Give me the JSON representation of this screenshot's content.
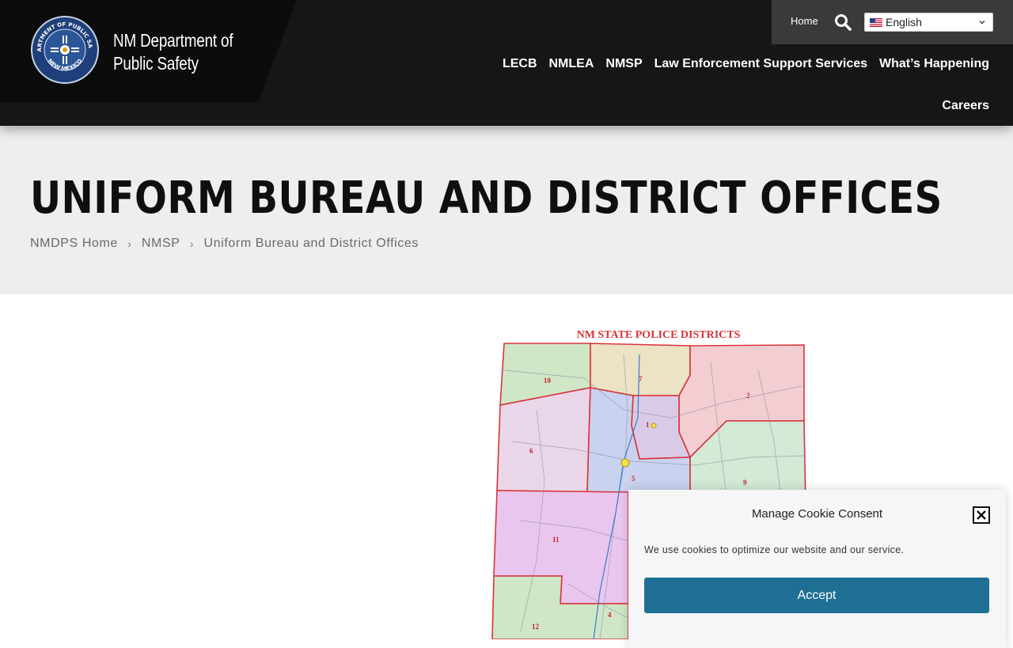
{
  "brand": {
    "line1": "NM Department of",
    "line2": "Public Safety",
    "seal_top_text": "DEPARTMENT OF PUBLIC SAFETY",
    "seal_bottom_text": "NEW MEXICO"
  },
  "utility": {
    "home_label": "Home",
    "search_icon": "search-icon",
    "language": "English"
  },
  "nav": {
    "items": [
      "LECB",
      "NMLEA",
      "NMSP",
      "Law Enforcement Support Services",
      "What’s Happening",
      "Careers"
    ]
  },
  "hero": {
    "title": "UNIFORM BUREAU AND DISTRICT OFFICES",
    "breadcrumb": [
      "NMDPS Home",
      "NMSP",
      "Uniform Bureau and District Offices"
    ],
    "separator": "›"
  },
  "map": {
    "title": "NM STATE POLICE  DISTRICTS",
    "districts": [
      "10",
      "7",
      "2",
      "1",
      "6",
      "5",
      "9",
      "11",
      "4",
      "12"
    ]
  },
  "cookie": {
    "title": "Manage Cookie Consent",
    "text": "We use cookies to optimize our website and our service.",
    "accept_label": "Accept"
  },
  "colors": {
    "header_bg": "#161616",
    "hero_bg": "#eeedef",
    "accent": "#1e6f93",
    "map_border": "#d9343b"
  }
}
